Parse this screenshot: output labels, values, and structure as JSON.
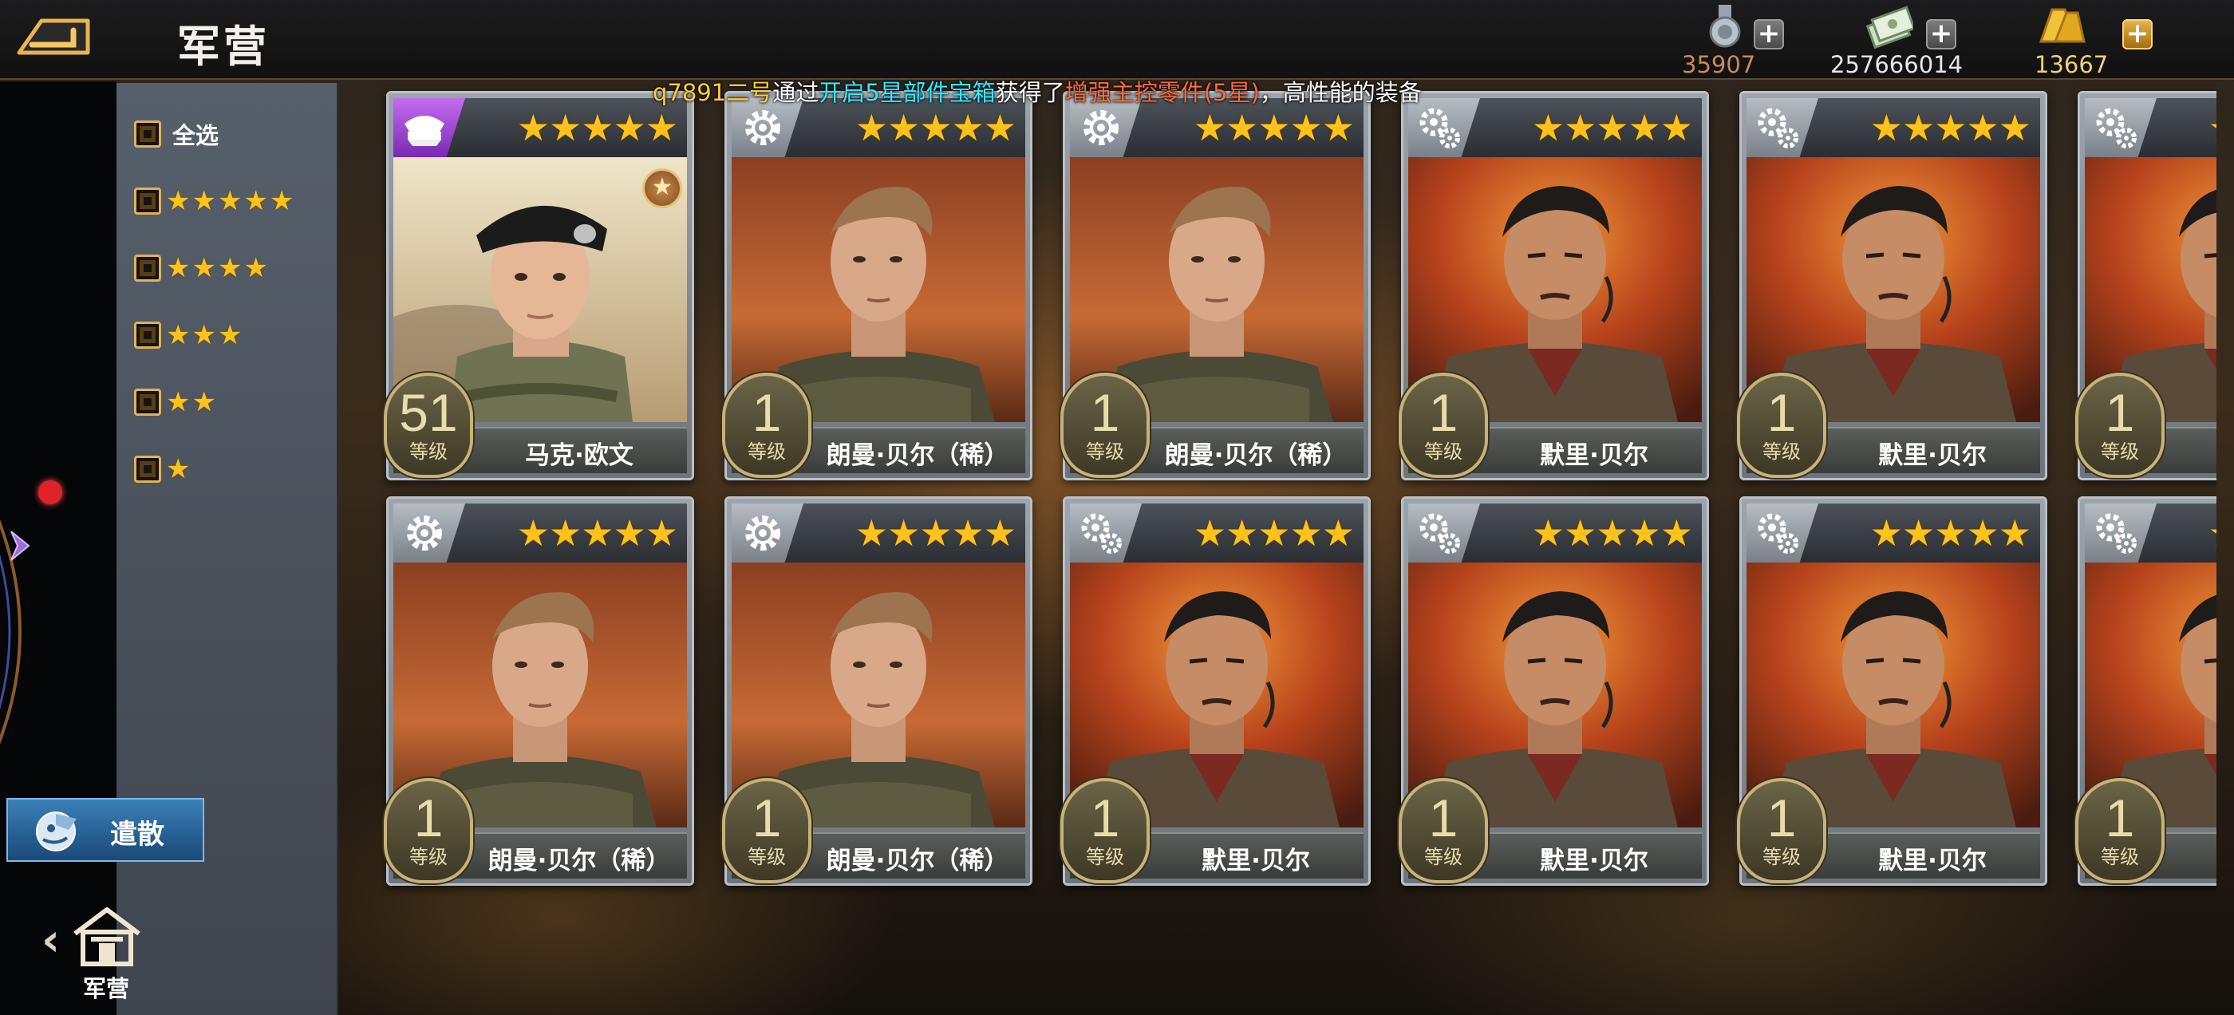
{
  "header": {
    "title": "军营",
    "resources": [
      {
        "name": "medal",
        "icon": "medal-icon",
        "value": "35907",
        "color": "#c98a54"
      },
      {
        "name": "cash",
        "icon": "cash-icon",
        "value": "257666014",
        "color": "#e6e6e6"
      },
      {
        "name": "gold",
        "icon": "gold-bar-icon",
        "value": "13667",
        "color": "#f0d070"
      }
    ],
    "plus_label": "+"
  },
  "broadcast": {
    "player": "q7891二号",
    "text1": "通过",
    "source": "开启5星部件宝箱",
    "text2": "获得了",
    "item": "增强主控零件(5星)",
    "text3": "，高性能的装备"
  },
  "filters": {
    "select_all_label": "全选",
    "star_rows": [
      {
        "stars": "★★★★★",
        "count": 5
      },
      {
        "stars": "★★★★",
        "count": 4
      },
      {
        "stars": "★★★",
        "count": 3
      },
      {
        "stars": "★★",
        "count": 2
      },
      {
        "stars": "★",
        "count": 1
      }
    ]
  },
  "dismiss_button": {
    "label": "遣散"
  },
  "barracks_nav": {
    "label": "军营"
  },
  "level_label": "等级",
  "cards": [
    {
      "name": "马克·欧文",
      "level": "51",
      "stars": "★★★★★",
      "type": "officer-cap-icon",
      "portrait": "beret"
    },
    {
      "name": "朗曼·贝尔（稀）",
      "level": "1",
      "stars": "★★★★★",
      "type": "gear-icon",
      "portrait": "blond"
    },
    {
      "name": "朗曼·贝尔（稀）",
      "level": "1",
      "stars": "★★★★★",
      "type": "gear-icon",
      "portrait": "blond"
    },
    {
      "name": "默里·贝尔",
      "level": "1",
      "stars": "★★★★★",
      "type": "gears-icon",
      "portrait": "dark"
    },
    {
      "name": "默里·贝尔",
      "level": "1",
      "stars": "★★★★★",
      "type": "gears-icon",
      "portrait": "dark"
    },
    {
      "name": "",
      "level": "1",
      "stars": "★★★★★",
      "type": "gears-icon",
      "portrait": "dark"
    },
    {
      "name": "朗曼·贝尔（稀）",
      "level": "1",
      "stars": "★★★★★",
      "type": "gear-icon",
      "portrait": "blond"
    },
    {
      "name": "朗曼·贝尔（稀）",
      "level": "1",
      "stars": "★★★★★",
      "type": "gear-icon",
      "portrait": "blond"
    },
    {
      "name": "默里·贝尔",
      "level": "1",
      "stars": "★★★★★",
      "type": "gears-icon",
      "portrait": "dark"
    },
    {
      "name": "默里·贝尔",
      "level": "1",
      "stars": "★★★★★",
      "type": "gears-icon",
      "portrait": "dark"
    },
    {
      "name": "默里·贝尔",
      "level": "1",
      "stars": "★★★★★",
      "type": "gears-icon",
      "portrait": "dark"
    },
    {
      "name": "",
      "level": "1",
      "stars": "★★★★★",
      "type": "gears-icon",
      "portrait": "dark"
    }
  ]
}
